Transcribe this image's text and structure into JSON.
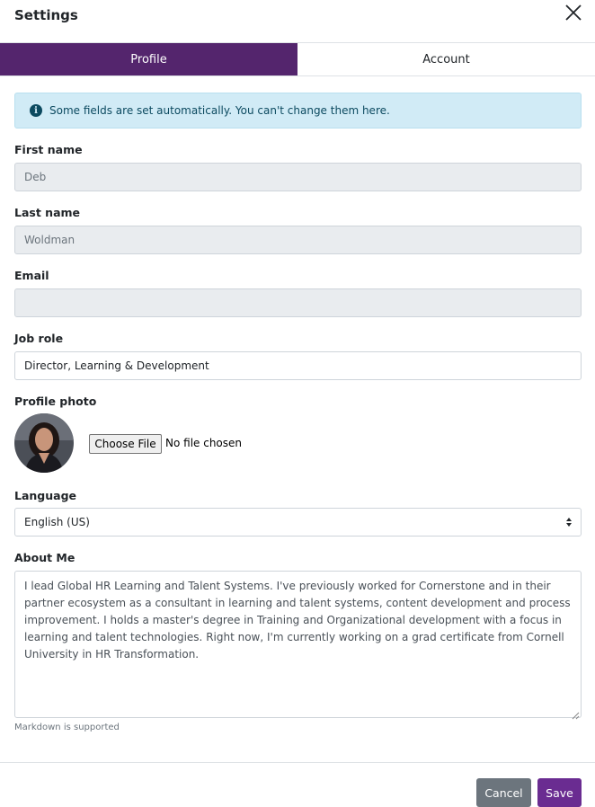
{
  "header": {
    "title": "Settings",
    "close_icon": "close-icon"
  },
  "tabs": [
    {
      "label": "Profile",
      "active": true
    },
    {
      "label": "Account",
      "active": false
    }
  ],
  "alert": {
    "icon": "info-icon",
    "text": "Some fields are set automatically. You can't change them here."
  },
  "form": {
    "first_name": {
      "label": "First name",
      "value": "Deb"
    },
    "last_name": {
      "label": "Last name",
      "value": "Woldman"
    },
    "email": {
      "label": "Email",
      "value": ""
    },
    "job_role": {
      "label": "Job role",
      "value": "Director, Learning & Development"
    },
    "profile_photo": {
      "label": "Profile photo",
      "button": "Choose File",
      "status": "No file chosen"
    },
    "language": {
      "label": "Language",
      "value": "English (US)"
    },
    "about_me": {
      "label": "About Me",
      "value": "I lead Global HR Learning and Talent Systems. I've previously worked for Cornerstone and in their partner ecosystem as a consultant in learning and talent systems, content development and process improvement. I holds a master's degree in Training and Organizational development with a focus in learning and talent technologies. Right now, I'm currently working on a grad certificate from Cornell University in HR Transformation.",
      "hint": "Markdown is supported"
    }
  },
  "footer": {
    "cancel_label": "Cancel",
    "save_label": "Save"
  },
  "colors": {
    "accent": "#54256d",
    "save": "#6a2c91",
    "cancel": "#6c757d",
    "alert_bg": "#d1ebf6"
  }
}
